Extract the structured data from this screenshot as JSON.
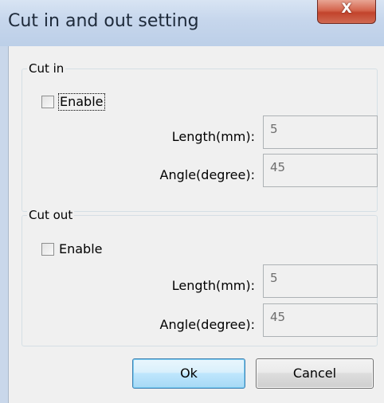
{
  "window": {
    "title": "Cut in and out setting",
    "close_glyph": "X"
  },
  "cut_in": {
    "group_label": "Cut in",
    "enable_label": "Enable",
    "enable_checked": false,
    "length_label": "Length(mm):",
    "length_value": "5",
    "angle_label": "Angle(degree):",
    "angle_value": "45"
  },
  "cut_out": {
    "group_label": "Cut out",
    "enable_label": "Enable",
    "enable_checked": false,
    "length_label": "Length(mm):",
    "length_value": "5",
    "angle_label": "Angle(degree):",
    "angle_value": "45"
  },
  "buttons": {
    "ok_label": "Ok",
    "cancel_label": "Cancel"
  }
}
